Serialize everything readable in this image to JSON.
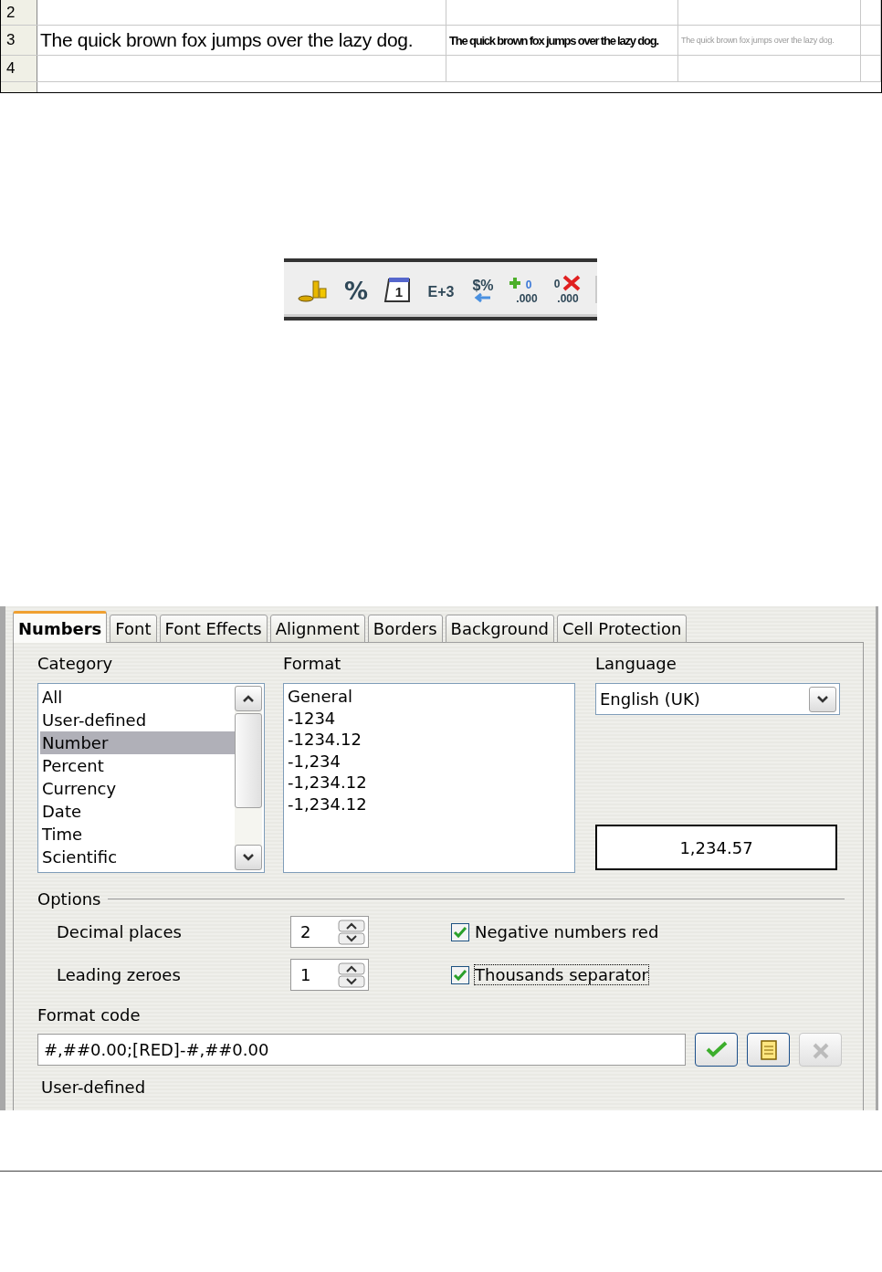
{
  "sheet": {
    "rows": [
      {
        "header": "2"
      },
      {
        "header": "3",
        "cells": [
          "The quick brown fox jumps over the lazy dog.",
          "The quick brown fox jumps over the lazy dog.",
          "The quick brown fox jumps over the lazy dog."
        ]
      },
      {
        "header": "4"
      }
    ]
  },
  "toolbar": {
    "buttons": [
      {
        "kind": "currency"
      },
      {
        "kind": "percent",
        "glyph": "%"
      },
      {
        "kind": "date",
        "glyph": "1"
      },
      {
        "kind": "exponent",
        "glyph": "E+3"
      },
      {
        "kind": "standard",
        "glyph": "$%"
      },
      {
        "kind": "add-decimal",
        "glyph": "0",
        "glyph2": ".000"
      },
      {
        "kind": "delete-decimal",
        "glyph": "0",
        "glyph2": ".000"
      }
    ]
  },
  "dialog": {
    "tabs": [
      {
        "label": "Numbers",
        "selected": true
      },
      {
        "label": "Font",
        "selected": false
      },
      {
        "label": "Font Effects",
        "selected": false
      },
      {
        "label": "Alignment",
        "selected": false
      },
      {
        "label": "Borders",
        "selected": false
      },
      {
        "label": "Background",
        "selected": false
      },
      {
        "label": "Cell Protection",
        "selected": false
      }
    ],
    "category": {
      "label": "Category",
      "items": [
        {
          "label": "All",
          "selected": false
        },
        {
          "label": "User-defined",
          "selected": false
        },
        {
          "label": "Number",
          "selected": true
        },
        {
          "label": "Percent",
          "selected": false
        },
        {
          "label": "Currency",
          "selected": false
        },
        {
          "label": "Date",
          "selected": false
        },
        {
          "label": "Time",
          "selected": false
        },
        {
          "label": "Scientific",
          "selected": false
        }
      ]
    },
    "format": {
      "label": "Format",
      "items": [
        {
          "label": "General",
          "selected": false
        },
        {
          "label": "-1234",
          "selected": false
        },
        {
          "label": "-1234.12",
          "selected": false
        },
        {
          "label": "-1,234",
          "selected": false
        },
        {
          "label": "-1,234.12",
          "selected": false
        },
        {
          "label": "-1,234.12",
          "selected": false
        }
      ]
    },
    "language": {
      "label": "Language",
      "value": "English (UK)"
    },
    "preview": "1,234.57",
    "options": {
      "title": "Options",
      "spinners": [
        {
          "label": "Decimal places",
          "value": "2"
        },
        {
          "label": "Leading zeroes",
          "value": "1"
        }
      ],
      "checkboxes": [
        {
          "label": "Negative numbers red",
          "checked": true,
          "focused": false
        },
        {
          "label": "Thousands separator",
          "checked": true,
          "focused": true
        }
      ]
    },
    "format_code": {
      "label": "Format code",
      "value": "#,##0.00;[RED]-#,##0.00",
      "buttons": [
        {
          "kind": "accept",
          "disabled": false
        },
        {
          "kind": "comment",
          "disabled": false
        },
        {
          "kind": "delete",
          "disabled": true
        }
      ]
    },
    "description": "User-defined"
  }
}
